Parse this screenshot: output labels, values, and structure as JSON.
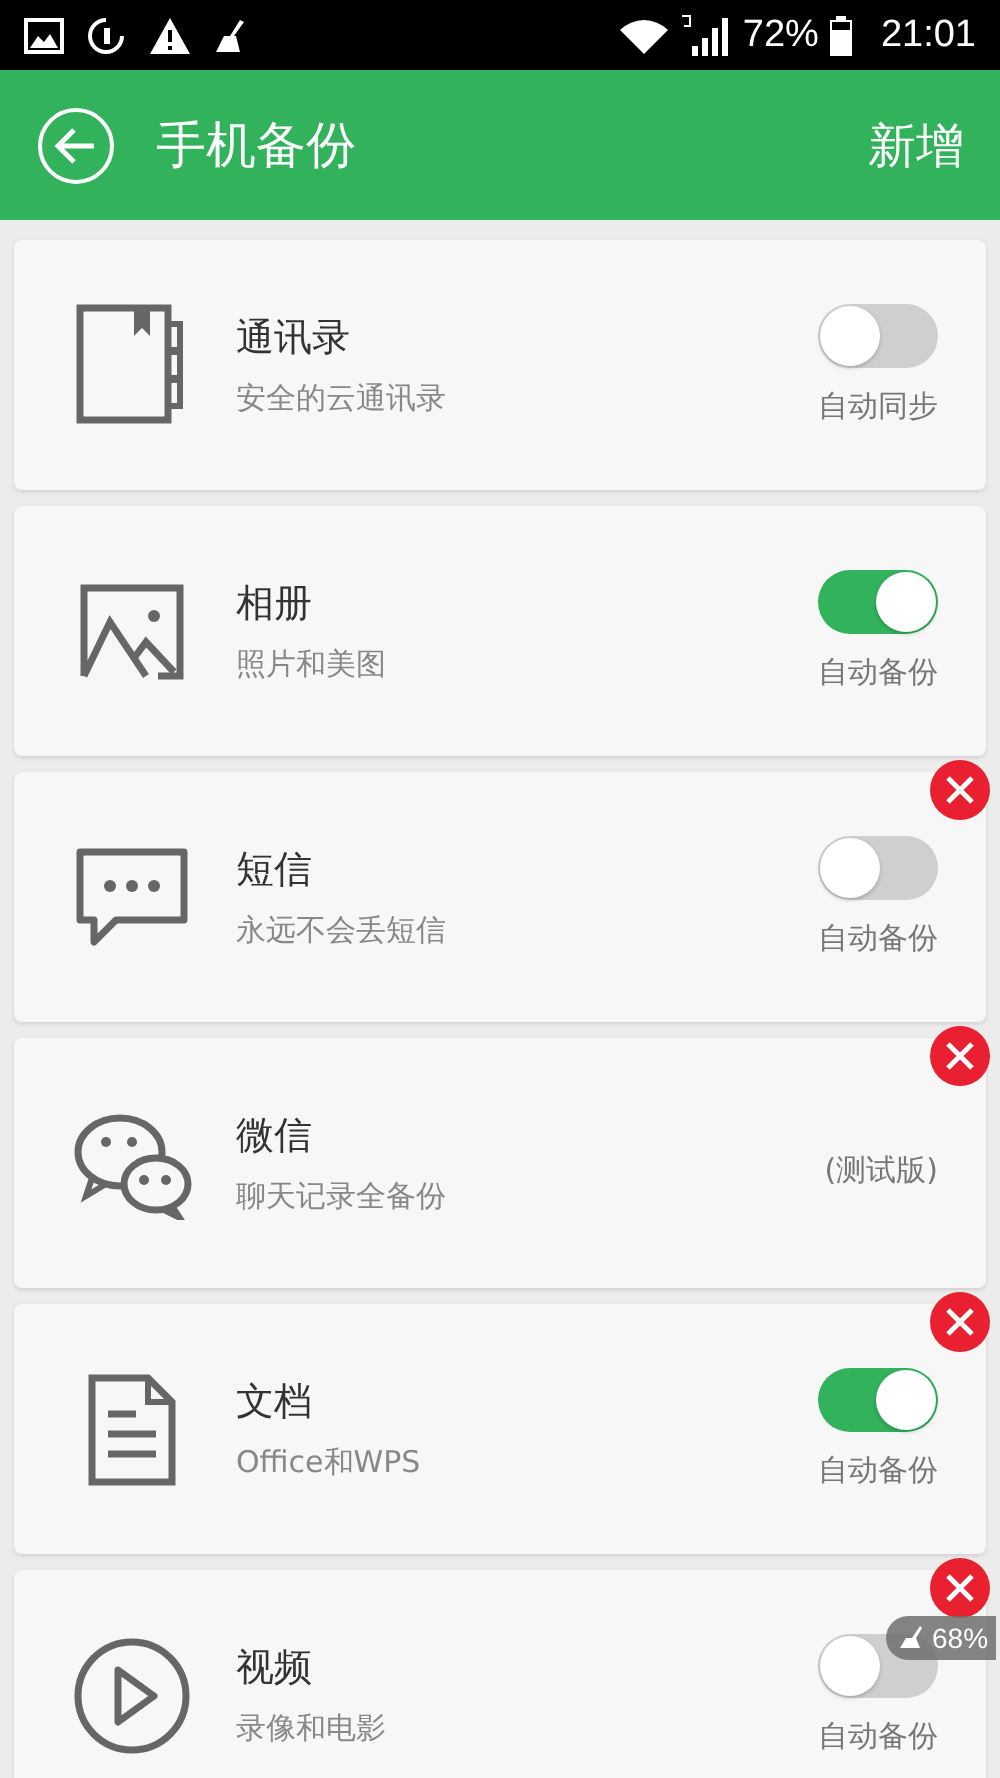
{
  "status_bar": {
    "battery": "72%",
    "time": "21:01"
  },
  "header": {
    "title": "手机备份",
    "action": "新增"
  },
  "items": [
    {
      "kind": "toggle",
      "title": "通讯录",
      "subtitle": "安全的云通讯录",
      "on": false,
      "caption": "自动同步",
      "deletable": false
    },
    {
      "kind": "toggle",
      "title": "相册",
      "subtitle": "照片和美图",
      "on": true,
      "caption": "自动备份",
      "deletable": false
    },
    {
      "kind": "toggle",
      "title": "短信",
      "subtitle": "永远不会丢短信",
      "on": false,
      "caption": "自动备份",
      "deletable": true
    },
    {
      "kind": "note",
      "title": "微信",
      "subtitle": "聊天记录全备份",
      "caption": "(测试版)",
      "deletable": true
    },
    {
      "kind": "toggle",
      "title": "文档",
      "subtitle": "Office和WPS",
      "on": true,
      "caption": "自动备份",
      "deletable": true
    },
    {
      "kind": "toggle",
      "title": "视频",
      "subtitle": "录像和电影",
      "on": false,
      "caption": "自动备份",
      "deletable": true
    }
  ],
  "floating_widget": {
    "reading": "68%"
  }
}
